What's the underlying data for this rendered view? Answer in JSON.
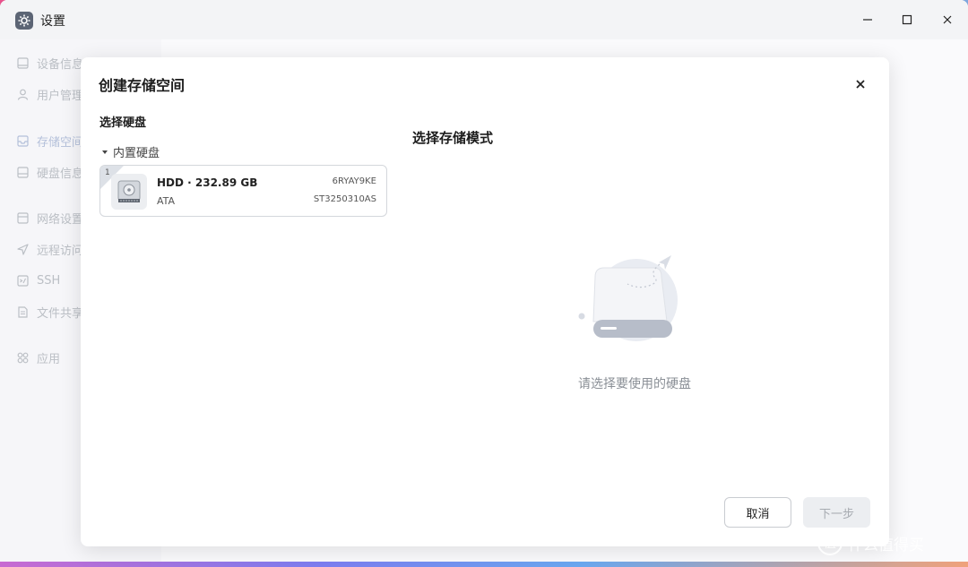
{
  "window": {
    "title": "设置",
    "icon": "gear-icon"
  },
  "sidebar": {
    "items": [
      {
        "label": "设备信息",
        "icon": "device-icon"
      },
      {
        "label": "用户管理",
        "icon": "user-icon"
      },
      {
        "label": "存储空间",
        "icon": "storage-icon"
      },
      {
        "label": "硬盘信息",
        "icon": "disk-icon"
      },
      {
        "label": "网络设置",
        "icon": "network-icon"
      },
      {
        "label": "远程访问",
        "icon": "send-icon"
      },
      {
        "label": "SSH",
        "icon": "terminal-icon"
      },
      {
        "label": "文件共享",
        "icon": "file-icon"
      },
      {
        "label": "应用",
        "icon": "apps-icon"
      }
    ]
  },
  "dialog": {
    "title": "创建存储空间",
    "select_disk_title": "选择硬盘",
    "group_label": "内置硬盘",
    "disk": {
      "index": "1",
      "name": "HDD · 232.89 GB",
      "type": "ATA",
      "serial": "6RYAY9KE",
      "model": "ST3250310AS"
    },
    "mode_title": "选择存储模式",
    "empty_text": "请选择要使用的硬盘",
    "cancel_label": "取消",
    "next_label": "下一步"
  },
  "watermark": {
    "logo": "值",
    "text": "什么值得买"
  }
}
